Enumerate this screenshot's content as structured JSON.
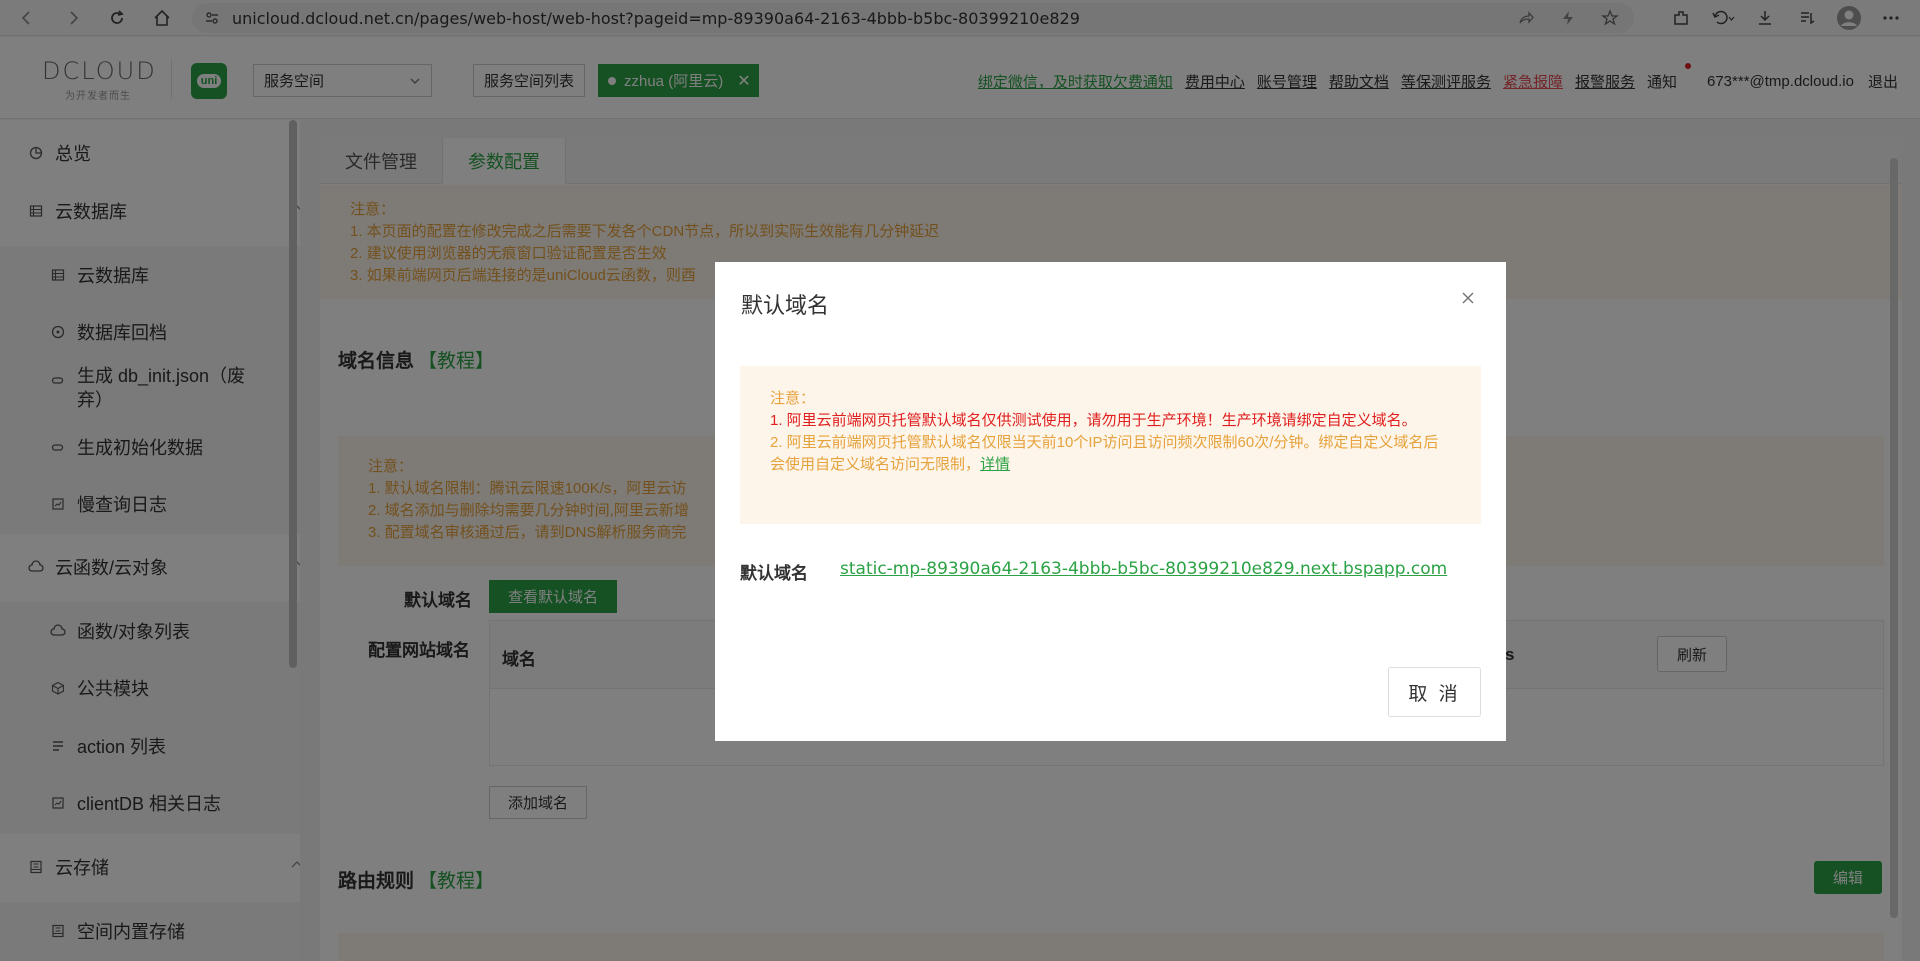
{
  "browser": {
    "url": "unicloud.dcloud.net.cn/pages/web-host/web-host?pageid=mp-89390a64-2163-4bbb-b5bc-80399210e829"
  },
  "header": {
    "logo_text": "DCLOUD",
    "logo_sub": "为开发者而生",
    "uni_label": "uni",
    "space_select_value": "服务空间",
    "space_list_btn": "服务空间列表",
    "env_tag": "zzhua (阿里云)",
    "links": {
      "bind_wechat": "绑定微信，及时获取欠费通知",
      "billing": "费用中心",
      "account": "账号管理",
      "help": "帮助文档",
      "security_eval": "等保测评服务",
      "emergency": "紧急报障",
      "alarm": "报警服务",
      "notify": "通知",
      "user": "673***@tmp.dcloud.io",
      "logout": "退出"
    }
  },
  "sidebar": {
    "overview": "总览",
    "db_group": "云数据库",
    "db_items": [
      "云数据库",
      "数据库回档",
      "生成 db_init.json（废弃）",
      "生成初始化数据",
      "慢查询日志"
    ],
    "func_group": "云函数/云对象",
    "func_items": [
      "函数/对象列表",
      "公共模块",
      "action 列表",
      "clientDB 相关日志"
    ],
    "storage_group": "云存储",
    "storage_items": [
      "空间内置存储"
    ]
  },
  "main": {
    "tabs": [
      "文件管理",
      "参数配置"
    ],
    "top_notice": {
      "title": "注意：",
      "lines": [
        "1. 本页面的配置在修改完成之后需要下发各个CDN节点，所以到实际生效能有几分钟延迟",
        "2. 建议使用浏览器的无痕窗口验证配置是否生效",
        "3. 如果前端网页后端连接的是uniCloud云函数，则酉"
      ]
    },
    "domain_section": {
      "title": "域名信息",
      "tutorial": "【教程】",
      "notice_title": "注意：",
      "notice_lines": [
        "1. 默认域名限制：腾讯云限速100K/s，阿里云访",
        "2. 域名添加与删除均需要几分钟时间,阿里云新增",
        "3. 配置域名审核通过后，请到DNS解析服务商完"
      ],
      "default_domain_label": "默认域名",
      "view_default_btn": "查看默认域名",
      "config_domain_label": "配置网站域名",
      "table_header_domain": "域名",
      "table_header_tail": "s",
      "refresh_btn": "刷新",
      "add_domain_btn": "添加域名"
    },
    "route_section": {
      "title": "路由规则",
      "tutorial": "【教程】",
      "edit_btn": "编辑"
    }
  },
  "modal": {
    "title": "默认域名",
    "notice_title": "注意：",
    "notice_red": "1. 阿里云前端网页托管默认域名仅供测试使用，请勿用于生产环境！生产环境请绑定自定义域名。",
    "notice_orange": "2. 阿里云前端网页托管默认域名仅限当天前10个IP访问且访问频次限制60次/分钟。绑定自定义域名后会使用自定义域名访问无限制，",
    "notice_link": "详情",
    "field_label": "默认域名",
    "field_value": "static-mp-89390a64-2163-4bbb-b5bc-80399210e829.next.bspapp.com",
    "cancel_btn": "取 消"
  },
  "colors": {
    "brand_green": "#2ba245",
    "warning_orange": "#e6a23c",
    "danger_red": "#e02020",
    "notice_bg": "#fdf5ea"
  }
}
